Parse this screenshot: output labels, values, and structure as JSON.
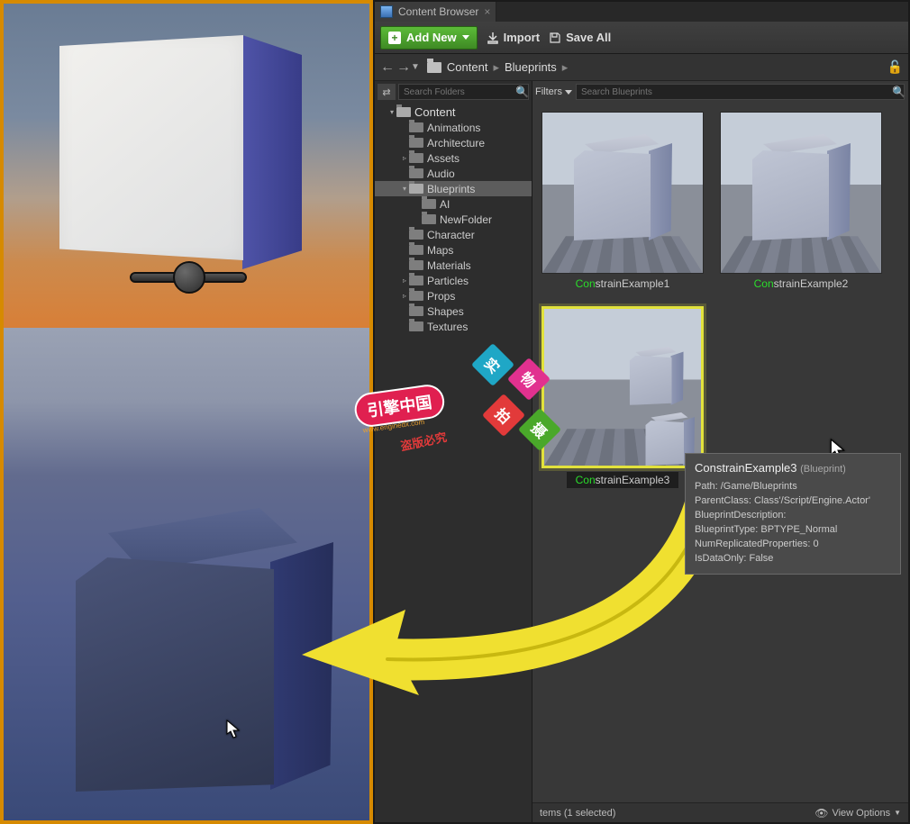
{
  "tab": {
    "title": "Content Browser"
  },
  "toolbar": {
    "add_new": "Add New",
    "import": "Import",
    "save_all": "Save All"
  },
  "breadcrumb": {
    "root": "Content",
    "folder": "Blueprints"
  },
  "tree": {
    "search_placeholder": "Search Folders",
    "root": "Content",
    "items": [
      {
        "label": "Animations",
        "indent": 2,
        "expand": ""
      },
      {
        "label": "Architecture",
        "indent": 2,
        "expand": ""
      },
      {
        "label": "Assets",
        "indent": 2,
        "expand": "▹"
      },
      {
        "label": "Audio",
        "indent": 2,
        "expand": ""
      },
      {
        "label": "Blueprints",
        "indent": 2,
        "expand": "▾",
        "selected": true,
        "open": true
      },
      {
        "label": "AI",
        "indent": 3,
        "expand": ""
      },
      {
        "label": "NewFolder",
        "indent": 3,
        "expand": ""
      },
      {
        "label": "Character",
        "indent": 2,
        "expand": ""
      },
      {
        "label": "Maps",
        "indent": 2,
        "expand": ""
      },
      {
        "label": "Materials",
        "indent": 2,
        "expand": ""
      },
      {
        "label": "Particles",
        "indent": 2,
        "expand": "▹"
      },
      {
        "label": "Props",
        "indent": 2,
        "expand": "▹"
      },
      {
        "label": "Shapes",
        "indent": 2,
        "expand": ""
      },
      {
        "label": "Textures",
        "indent": 2,
        "expand": ""
      }
    ]
  },
  "grid": {
    "filters_label": "Filters",
    "search_placeholder": "Search Blueprints",
    "assets": [
      {
        "prefix": "Con",
        "rest": "strainExample1",
        "selected": false
      },
      {
        "prefix": "Con",
        "rest": "strainExample2",
        "selected": false
      },
      {
        "prefix": "Con",
        "rest": "strainExample3",
        "selected": true
      }
    ]
  },
  "tooltip": {
    "name": "ConstrainExample3",
    "type": "(Blueprint)",
    "path": "Path: /Game/Blueprints",
    "parent_class": "ParentClass: Class'/Script/Engine.Actor'",
    "desc": "BlueprintDescription:",
    "bp_type": "BlueprintType: BPTYPE_Normal",
    "num_rep": "NumReplicatedProperties: 0",
    "data_only": "IsDataOnly: False"
  },
  "status": {
    "left": "tems (1 selected)",
    "view_options": "View Options"
  },
  "watermark": {
    "brand": "引擎中国",
    "url": "www.enginedx.com",
    "sq1": "实",
    "sq2": "物",
    "sq3": "拍",
    "sq4": "摄",
    "line": "盗版必究"
  }
}
